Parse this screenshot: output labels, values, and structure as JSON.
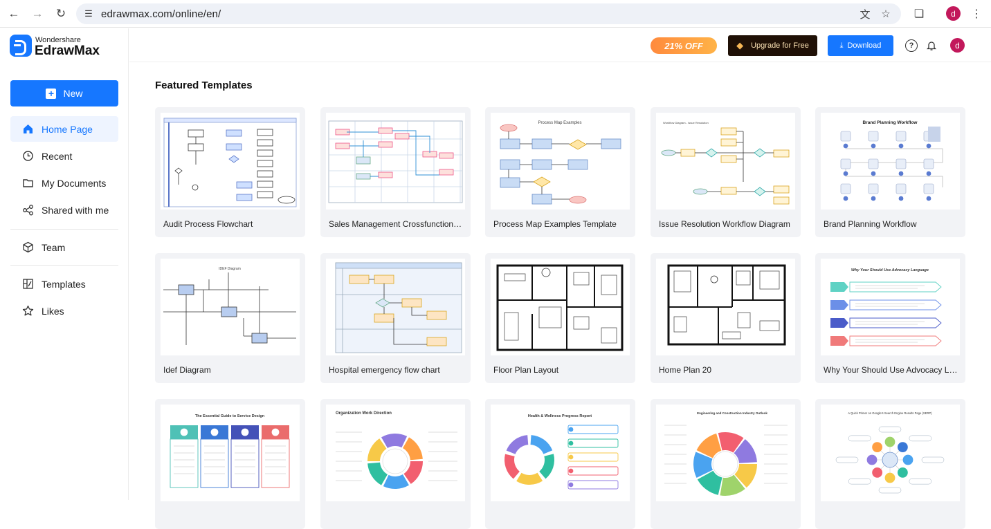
{
  "browser": {
    "url": "edrawmax.com/online/en/",
    "profile_initial": "d"
  },
  "app": {
    "brand_top": "Wondershare",
    "brand_name": "EdrawMax",
    "accent": "#1677ff"
  },
  "sidebar": {
    "new_label": "New",
    "items": [
      {
        "label": "Home Page",
        "icon": "home-icon",
        "active": true
      },
      {
        "label": "Recent",
        "icon": "clock-icon"
      },
      {
        "label": "My Documents",
        "icon": "folder-icon"
      },
      {
        "label": "Shared with me",
        "icon": "share-icon"
      },
      {
        "label": "Team",
        "icon": "team-icon"
      },
      {
        "label": "Templates",
        "icon": "templates-icon"
      },
      {
        "label": "Likes",
        "icon": "star-icon"
      }
    ]
  },
  "topbar": {
    "promo": "21% OFF",
    "upgrade_label": "Upgrade for Free",
    "download_label": "Download",
    "avatar_initial": "d"
  },
  "main": {
    "section_title": "Featured Templates",
    "templates": [
      {
        "title": "Audit Process Flowchart",
        "thumb": "flow"
      },
      {
        "title": "Sales Management Crossfunctional P...",
        "thumb": "cross"
      },
      {
        "title": "Process Map Examples Template",
        "thumb": "process"
      },
      {
        "title": "Issue Resolution Workflow Diagram",
        "thumb": "issue"
      },
      {
        "title": "Brand Planning Workflow",
        "thumb": "brand"
      },
      {
        "title": "Idef Diagram",
        "thumb": "idef"
      },
      {
        "title": "Hospital emergency flow chart",
        "thumb": "hospital"
      },
      {
        "title": "Floor Plan Layout",
        "thumb": "floor"
      },
      {
        "title": "Home Plan 20",
        "thumb": "home"
      },
      {
        "title": "Why Your Should Use Advocacy Lang...",
        "thumb": "advocacy"
      },
      {
        "title": "",
        "thumb": "guide"
      },
      {
        "title": "",
        "thumb": "org"
      },
      {
        "title": "",
        "thumb": "health"
      },
      {
        "title": "",
        "thumb": "engineering"
      },
      {
        "title": "",
        "thumb": "serp"
      }
    ]
  }
}
